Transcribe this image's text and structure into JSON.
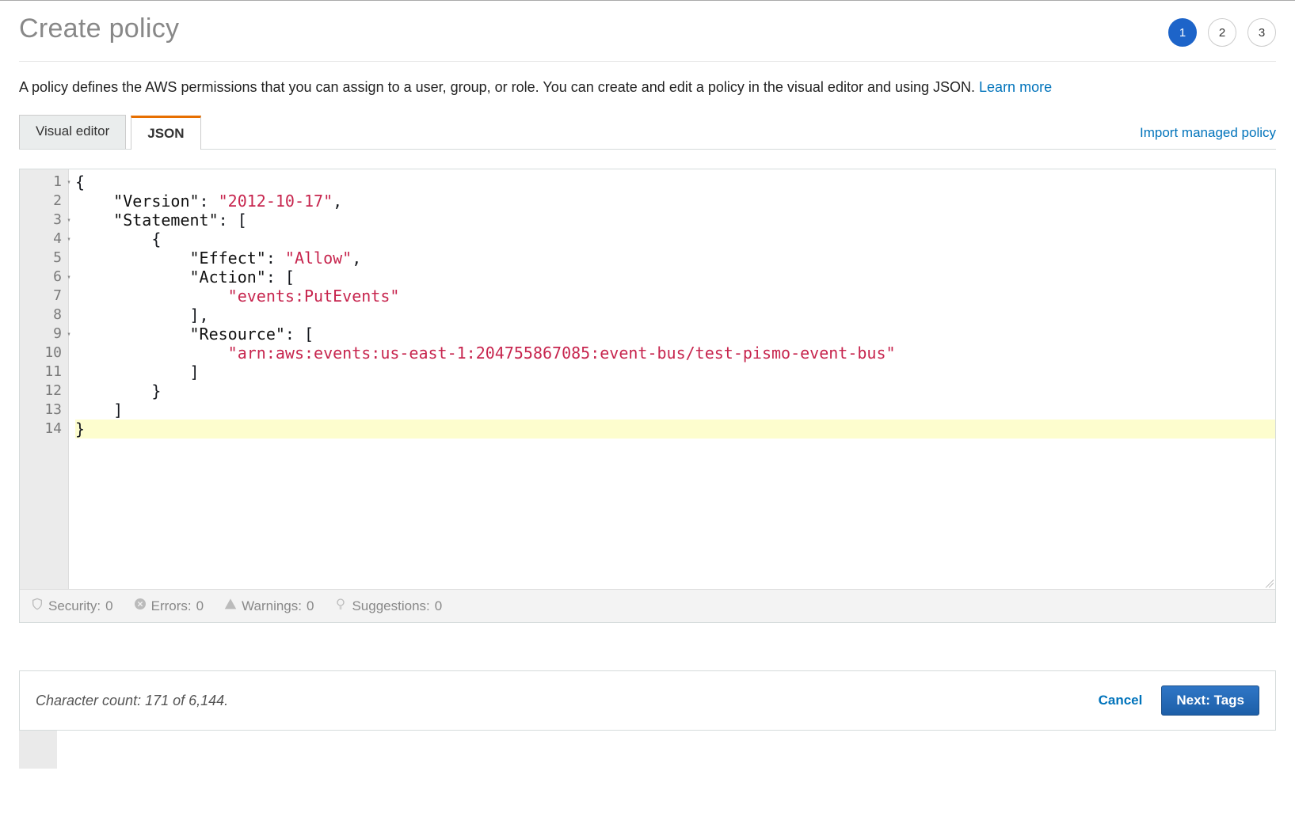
{
  "header": {
    "title": "Create policy",
    "steps": [
      "1",
      "2",
      "3"
    ],
    "active_step": 0
  },
  "description": {
    "text": "A policy defines the AWS permissions that you can assign to a user, group, or role. You can create and edit a policy in the visual editor and using JSON. ",
    "learn_more": "Learn more"
  },
  "tabs": {
    "items": [
      {
        "label": "Visual editor"
      },
      {
        "label": "JSON"
      }
    ],
    "active": 1,
    "import_link": "Import managed policy"
  },
  "editor": {
    "line_count": 14,
    "fold_lines": [
      1,
      3,
      4,
      6,
      9
    ],
    "highlight_line": 14,
    "policy": {
      "Version": "2012-10-17",
      "Statement": [
        {
          "Effect": "Allow",
          "Action": [
            "events:PutEvents"
          ],
          "Resource": [
            "arn:aws:events:us-east-1:204755867085:event-bus/test-pismo-event-bus"
          ]
        }
      ]
    }
  },
  "status": {
    "security": {
      "label": "Security:",
      "count": 0
    },
    "errors": {
      "label": "Errors:",
      "count": 0
    },
    "warnings": {
      "label": "Warnings:",
      "count": 0
    },
    "suggestions": {
      "label": "Suggestions:",
      "count": 0
    }
  },
  "footer": {
    "char_count_text": "Character count: 171 of 6,144.",
    "cancel": "Cancel",
    "next": "Next: Tags"
  }
}
